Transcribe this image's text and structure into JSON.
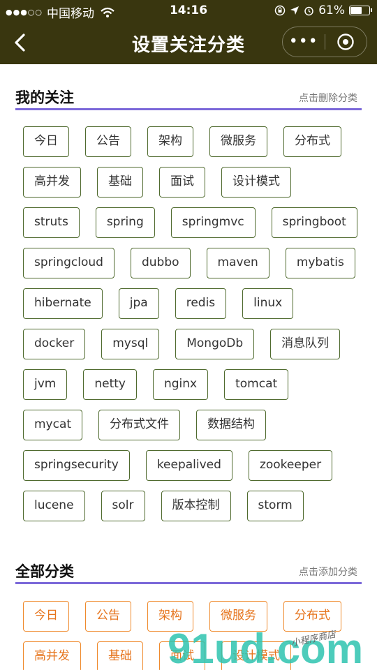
{
  "status_bar": {
    "carrier": "中国移动",
    "time": "14:16",
    "battery": "61%",
    "battery_level": 0.61
  },
  "nav": {
    "title": "设置关注分类",
    "more_icon": "more-dots-icon",
    "close_icon": "mini-program-close-icon"
  },
  "my_follows": {
    "title": "我的关注",
    "action": "点击删除分类",
    "tags": [
      "今日",
      "公告",
      "架构",
      "微服务",
      "分布式",
      "高并发",
      "基础",
      "面试",
      "设计模式",
      "struts",
      "spring",
      "springmvc",
      "springboot",
      "springcloud",
      "dubbo",
      "maven",
      "mybatis",
      "hibernate",
      "jpa",
      "redis",
      "linux",
      "docker",
      "mysql",
      "MongoDb",
      "消息队列",
      "jvm",
      "netty",
      "nginx",
      "tomcat",
      "mycat",
      "分布式文件",
      "数据结构",
      "springsecurity",
      "keepalived",
      "zookeeper",
      "lucene",
      "solr",
      "版本控制",
      "storm"
    ]
  },
  "all_categories": {
    "title": "全部分类",
    "action": "点击添加分类",
    "tags": [
      "今日",
      "公告",
      "架构",
      "微服务",
      "分布式",
      "高并发",
      "基础",
      "面试",
      "设计模式"
    ]
  },
  "watermark": {
    "logo": "91ud.com",
    "text": "小程序商店"
  },
  "colors": {
    "nav_bg": "#39360f",
    "underline": "#7b68d9",
    "followed_border": "#4f6a2e",
    "category_border": "#ef8a2c",
    "category_text": "#e6741c"
  }
}
